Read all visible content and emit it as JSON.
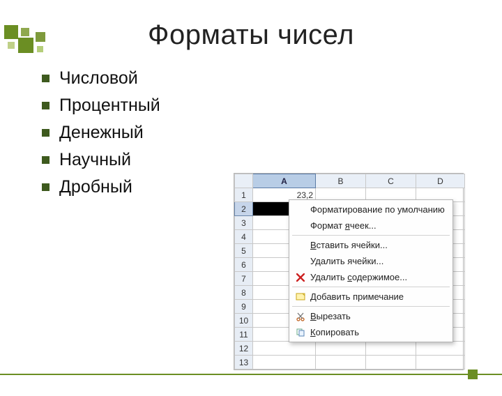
{
  "title": "Форматы чисел",
  "bullets": [
    "Числовой",
    "Процентный",
    "Денежный",
    "Научный",
    "Дробный"
  ],
  "sheet": {
    "columns": [
      "",
      "A",
      "B",
      "C",
      "D"
    ],
    "selected_column": "A",
    "selected_row": 2,
    "row_count": 13,
    "cells": {
      "A1": "23,2"
    }
  },
  "context_menu": {
    "items": [
      {
        "label": "Форматирование по умолчанию",
        "icon": null
      },
      {
        "label": "Формат ячеек...",
        "underline_index": 7,
        "icon": null
      },
      {
        "sep": true
      },
      {
        "label": "Вставить ячейки...",
        "underline_index": 0,
        "icon": null
      },
      {
        "label": "Удалить ячейки...",
        "icon": null
      },
      {
        "label": "Удалить содержимое...",
        "underline_index": 8,
        "icon": "x-red"
      },
      {
        "sep": true
      },
      {
        "label": "Добавить примечание",
        "underline_index": 0,
        "icon": "note"
      },
      {
        "sep": true
      },
      {
        "label": "Вырезать",
        "underline_index": 0,
        "icon": "cut"
      },
      {
        "label": "Копировать",
        "underline_index": 0,
        "icon": "copy"
      }
    ]
  }
}
